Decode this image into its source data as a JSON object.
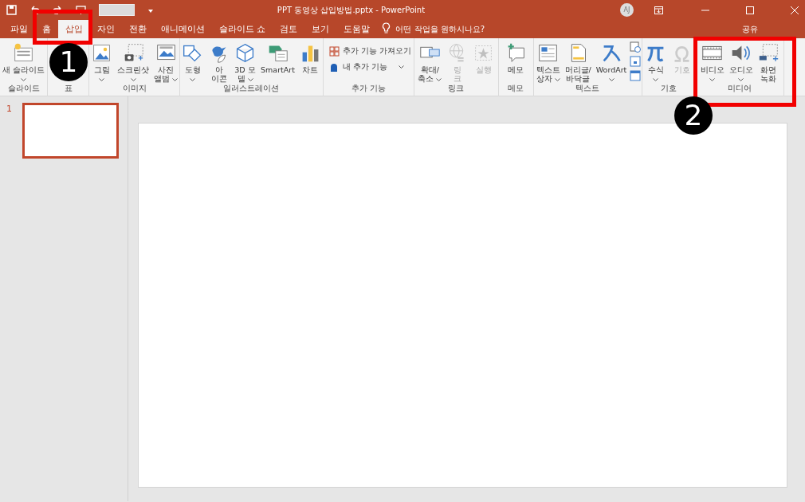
{
  "title_bar": {
    "title": "PPT 동영상 삽입방법.pptx  -  PowerPoint",
    "avatar": "AJ"
  },
  "tabs": [
    {
      "label": "파일",
      "selected": false
    },
    {
      "label": "홈",
      "selected": false
    },
    {
      "label": "삽입",
      "selected": true
    },
    {
      "label": "자인",
      "selected": false
    },
    {
      "label": "전환",
      "selected": false
    },
    {
      "label": "애니메이션",
      "selected": false
    },
    {
      "label": "슬라이드 쇼",
      "selected": false
    },
    {
      "label": "검토",
      "selected": false
    },
    {
      "label": "보기",
      "selected": false
    },
    {
      "label": "도움말",
      "selected": false
    }
  ],
  "tell_me": {
    "placeholder": "어떤 작업을 원하시나요?"
  },
  "share": "공유",
  "ribbon": {
    "groups": [
      {
        "label": "슬라이드",
        "buttons": [
          {
            "kind": "large",
            "label": "새 슬라이드",
            "dropdown": true,
            "disabled": false
          }
        ]
      },
      {
        "label": "표"
      },
      {
        "label": "이미지",
        "buttons": [
          {
            "kind": "large",
            "label": "그림",
            "dropdown": true,
            "disabled": false
          },
          {
            "kind": "large",
            "label": "스크린샷",
            "dropdown": true,
            "disabled": false
          },
          {
            "kind": "large",
            "label": "사진\n앨범",
            "dropdown": true,
            "disabled": false
          }
        ]
      },
      {
        "label": "일러스트레이션",
        "buttons": [
          {
            "kind": "large",
            "label": "도형",
            "dropdown": true,
            "disabled": false
          },
          {
            "kind": "large",
            "label": "아\n이콘",
            "dropdown": false,
            "disabled": false
          },
          {
            "kind": "large",
            "label": "3D 모\n델",
            "dropdown": true,
            "disabled": false
          },
          {
            "kind": "large",
            "label": "SmartArt",
            "dropdown": false,
            "disabled": false
          },
          {
            "kind": "large",
            "label": "차트",
            "dropdown": false,
            "disabled": false
          }
        ]
      },
      {
        "label": "추가 기능",
        "buttons": [
          {
            "kind": "small",
            "label": "추가 기능 가져오기",
            "dropdown": false,
            "disabled": false
          },
          {
            "kind": "small",
            "label": "내 추가 기능",
            "dropdown": true,
            "disabled": false
          }
        ]
      },
      {
        "label": "링크",
        "buttons": [
          {
            "kind": "large",
            "label": "확대/\n축소",
            "dropdown": true,
            "disabled": false
          },
          {
            "kind": "large",
            "label": "링\n크",
            "dropdown": false,
            "disabled": true
          },
          {
            "kind": "large",
            "label": "실행",
            "dropdown": false,
            "disabled": true
          }
        ]
      },
      {
        "label": "메모",
        "buttons": [
          {
            "kind": "large",
            "label": "메모",
            "dropdown": false,
            "disabled": false
          }
        ]
      },
      {
        "label": "텍스트",
        "buttons": [
          {
            "kind": "large",
            "label": "텍스트\n상자",
            "dropdown": true,
            "disabled": false
          },
          {
            "kind": "large",
            "label": "머리글/\n바닥글",
            "dropdown": false,
            "disabled": false
          },
          {
            "kind": "large",
            "label": "WordArt",
            "dropdown": true,
            "disabled": false
          },
          {
            "kind": "stack"
          }
        ]
      },
      {
        "label": "기호",
        "buttons": [
          {
            "kind": "large",
            "label": "수식",
            "dropdown": true,
            "disabled": false
          },
          {
            "kind": "large",
            "label": "기호",
            "dropdown": false,
            "disabled": true
          }
        ]
      },
      {
        "label": "미디어",
        "buttons": [
          {
            "kind": "large",
            "label": "비디오",
            "dropdown": true,
            "disabled": false
          },
          {
            "kind": "large",
            "label": "오디오",
            "dropdown": true,
            "disabled": false
          },
          {
            "kind": "large",
            "label": "화면\n녹화",
            "dropdown": false,
            "disabled": false
          }
        ]
      }
    ]
  },
  "slides": [
    {
      "number": "1",
      "selected": true
    }
  ],
  "annotations": [
    {
      "label": "1"
    },
    {
      "label": "2"
    }
  ]
}
